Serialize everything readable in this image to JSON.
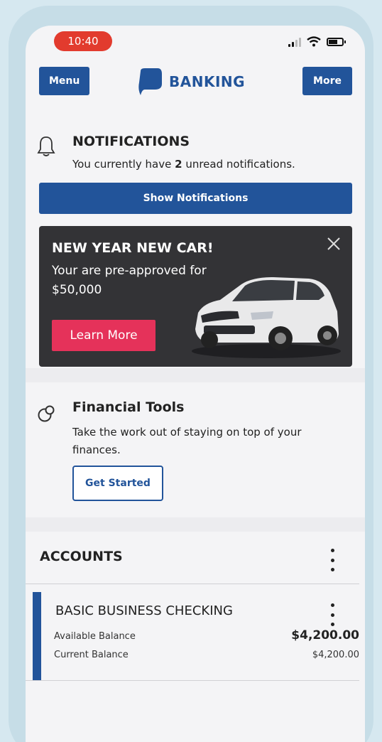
{
  "status_bar": {
    "time": "10:40"
  },
  "header": {
    "menu_label": "Menu",
    "brand": "BANKING",
    "more_label": "More"
  },
  "notifications": {
    "title": "NOTIFICATIONS",
    "text_before": "You currently have ",
    "count": "2",
    "text_after": " unread notifications.",
    "button_label": "Show Notifications"
  },
  "promo": {
    "title": "NEW YEAR NEW CAR!",
    "subtitle": "Your are pre-approved for $50,000",
    "button_label": "Learn More"
  },
  "financial_tools": {
    "title": "Financial Tools",
    "text": "Take the work out of staying on top of your finances.",
    "button_label": "Get Started"
  },
  "accounts": {
    "title": "ACCOUNTS",
    "items": [
      {
        "name": "BASIC BUSINESS CHECKING",
        "available_label": "Available Balance",
        "available_value": "$4,200.00",
        "current_label": "Current Balance",
        "current_value": "$4,200.00"
      }
    ]
  },
  "colors": {
    "brand_blue": "#22549a",
    "promo_pink": "#e5325a",
    "time_pill_red": "#e23b2e"
  }
}
